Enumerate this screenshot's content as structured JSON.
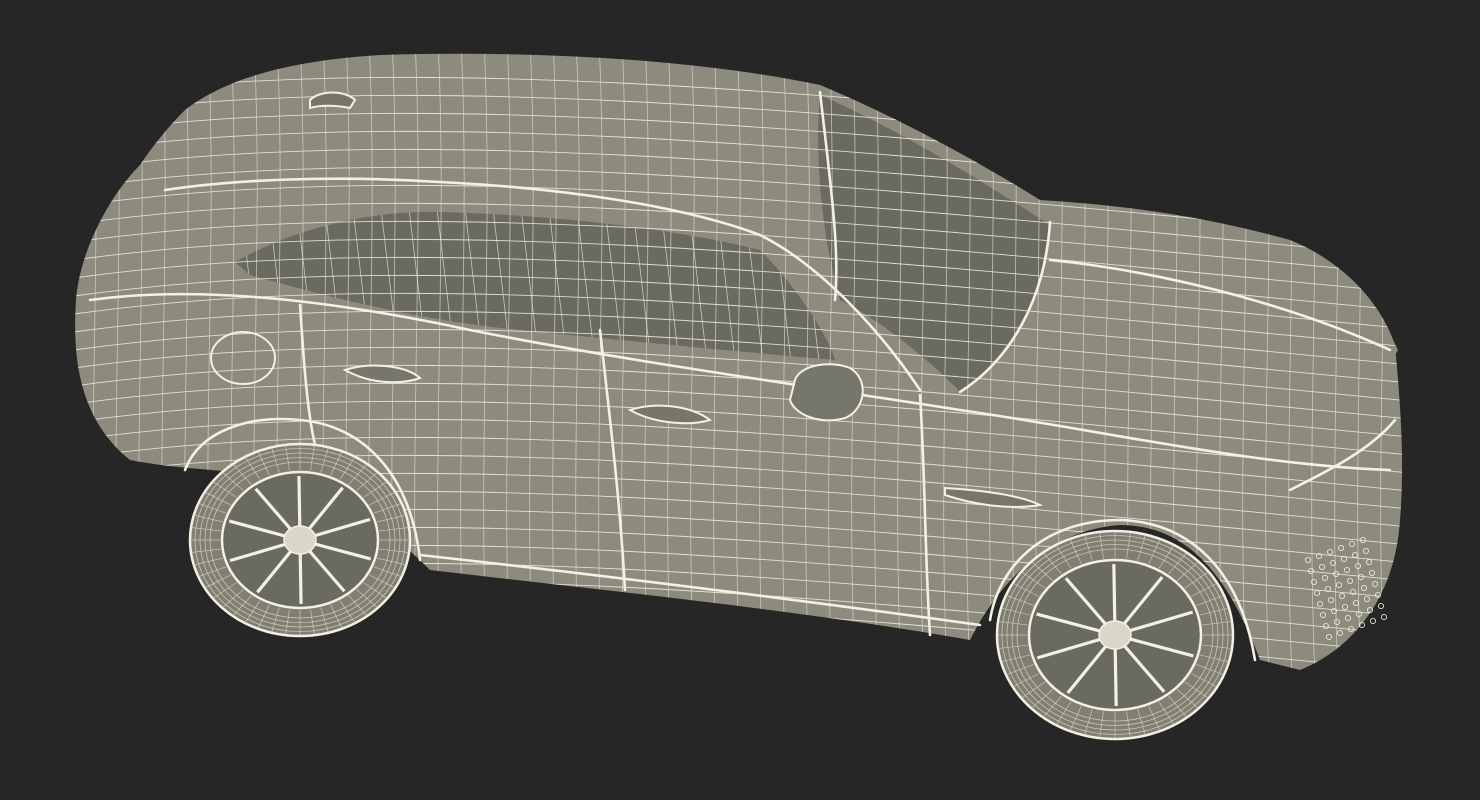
{
  "scene": {
    "subject": "car-wireframe",
    "render_style": "wireframe",
    "colors": {
      "background": "#262626",
      "body_fill": "#8c8b7e",
      "body_fill_shadow": "#77766a",
      "glass_fill": "#6b6a60",
      "wire": "#f2f1e4",
      "wire_dim": "#d9d8c8",
      "tire_fill": "#807f72"
    }
  }
}
